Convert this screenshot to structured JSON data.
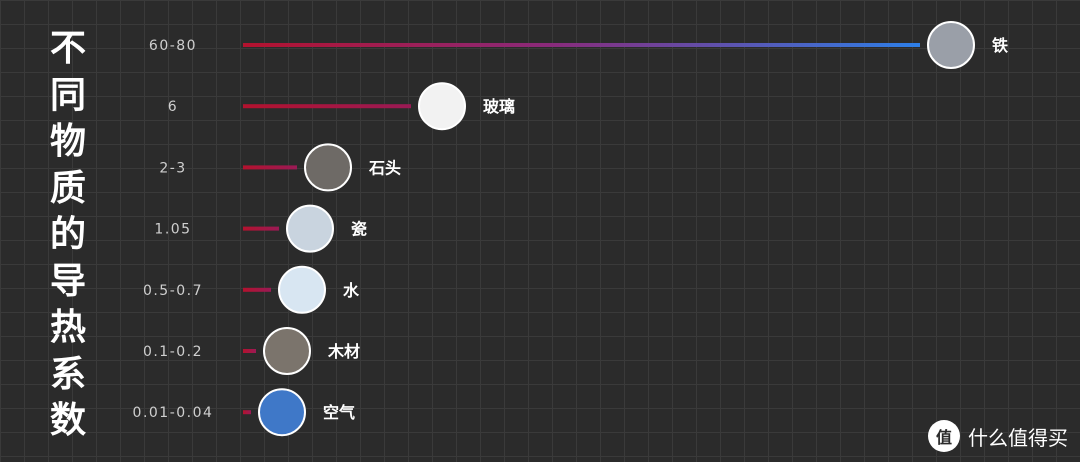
{
  "title_chars": [
    "不",
    "同",
    "物",
    "质",
    "的",
    "导",
    "热",
    "系",
    "数"
  ],
  "watermark": {
    "logo": "值",
    "text": "什么值得买"
  },
  "colors": {
    "bar_start": "#b3122e",
    "bar_end": "#2d7fe8",
    "text": "#cfcfcf",
    "label": "#ffffff"
  },
  "chart_data": {
    "type": "bar",
    "orientation": "horizontal",
    "title": "不同物质的导热系数",
    "categories": [
      "铁",
      "玻璃",
      "石头",
      "瓷",
      "水",
      "木材",
      "空气"
    ],
    "value_labels": [
      "60-80",
      "6",
      "2-3",
      "1.05",
      "0.5-0.7",
      "0.1-0.2",
      "0.01-0.04"
    ],
    "values": [
      80,
      6,
      2.5,
      1.05,
      0.6,
      0.15,
      0.025
    ],
    "icons": [
      "iron-icon",
      "glass-bottle-icon",
      "stones-icon",
      "porcelain-icon",
      "water-icon",
      "wood-icon",
      "air-icon"
    ],
    "grid": true,
    "legend": "none"
  }
}
